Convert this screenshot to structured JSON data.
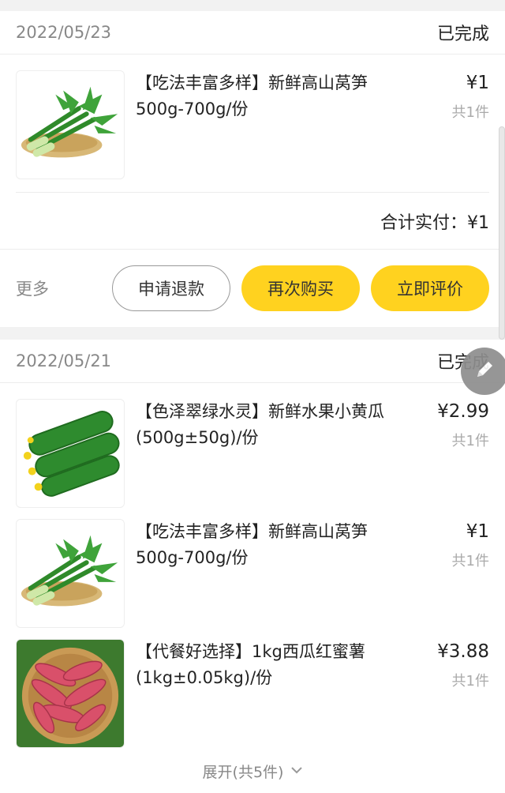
{
  "orders": [
    {
      "date": "2022/05/23",
      "status": "已完成",
      "items": [
        {
          "title": "【吃法丰富多样】新鲜高山莴笋500g-700g/份",
          "price": "¥1",
          "qty": "共1件",
          "image": "lettuce-image"
        }
      ],
      "total_label": "合计实付：¥1",
      "actions": {
        "more": "更多",
        "refund": "申请退款",
        "rebuy": "再次购买",
        "review": "立即评价"
      }
    },
    {
      "date": "2022/05/21",
      "status": "已完成",
      "items": [
        {
          "title": "【色泽翠绿水灵】新鲜水果小黄瓜 (500g±50g)/份",
          "price": "¥2.99",
          "qty": "共1件",
          "image": "cucumber-image"
        },
        {
          "title": "【吃法丰富多样】新鲜高山莴笋500g-700g/份",
          "price": "¥1",
          "qty": "共1件",
          "image": "lettuce-image"
        },
        {
          "title": "【代餐好选择】1kg西瓜红蜜薯(1kg±0.05kg)/份",
          "price": "¥3.88",
          "qty": "共1件",
          "image": "sweet-potato-image"
        }
      ],
      "expand_label": "展开(共5件)"
    }
  ],
  "colors": {
    "accent": "#ffd21f",
    "muted": "#888888",
    "background": "#f2f2f2"
  },
  "icons": {
    "expand": "chevron-down-icon",
    "edit": "edit-icon"
  }
}
